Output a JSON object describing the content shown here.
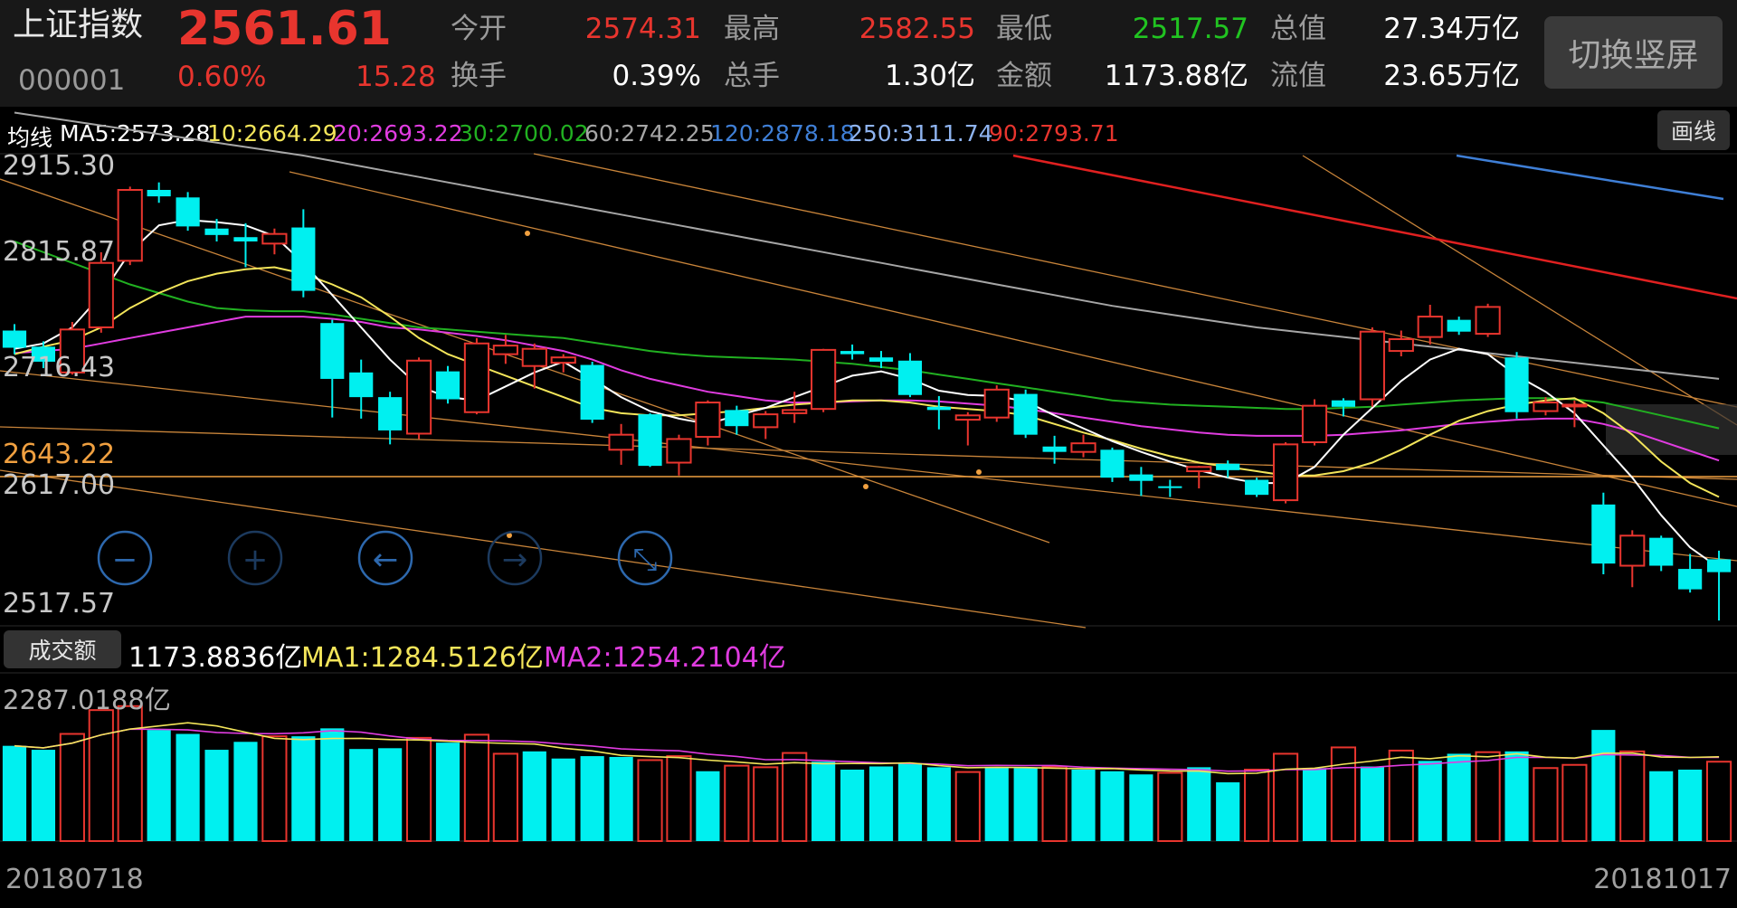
{
  "header": {
    "name": "上证指数",
    "code": "000001",
    "price": "2561.61",
    "change_pct": "0.60%",
    "change": "15.28",
    "fields": [
      {
        "label": "今开",
        "value": "2574.31",
        "color": "#e8352e"
      },
      {
        "label": "最高",
        "value": "2582.55",
        "color": "#e8352e"
      },
      {
        "label": "最低",
        "value": "2517.57",
        "color": "#21c421"
      },
      {
        "label": "总值",
        "value": "27.34万亿",
        "color": "#ffffff"
      },
      {
        "label": "换手",
        "value": "0.39%",
        "color": "#ffffff"
      },
      {
        "label": "总手",
        "value": "1.30亿",
        "color": "#ffffff"
      },
      {
        "label": "金额",
        "value": "1173.88亿",
        "color": "#ffffff"
      },
      {
        "label": "流值",
        "value": "23.65万亿",
        "color": "#ffffff"
      }
    ],
    "switch_label": "切换竖屏"
  },
  "ma_bar": {
    "label": "均线",
    "items": [
      {
        "text": "MA5:2573.28",
        "color": "#ffffff"
      },
      {
        "text": "10:2664.29",
        "color": "#f3e55a"
      },
      {
        "text": "20:2693.22",
        "color": "#e03ce0"
      },
      {
        "text": "30:2700.02",
        "color": "#21b021"
      },
      {
        "text": "60:2742.25",
        "color": "#a6a6a6"
      },
      {
        "text": "120:2878.18",
        "color": "#3f7fd6"
      },
      {
        "text": "250:3111.74",
        "color": "#8fb4f0"
      },
      {
        "text": "90:2793.71",
        "color": "#e8352e"
      }
    ],
    "draw_label": "画线"
  },
  "price_axis": {
    "ticks": [
      {
        "text": "2915.30",
        "color": "#c8c8c8"
      },
      {
        "text": "2815.87",
        "color": "#c8c8c8"
      },
      {
        "text": "2716.43",
        "color": "#c8c8c8"
      },
      {
        "text": "2643.22",
        "color": "#f0a040"
      },
      {
        "text": "2617.00",
        "color": "#c8c8c8"
      },
      {
        "text": "2517.57",
        "color": "#c8c8c8"
      }
    ]
  },
  "controls": [
    {
      "name": "zoom-out-icon",
      "glyph": "−"
    },
    {
      "name": "zoom-in-icon",
      "glyph": "+"
    },
    {
      "name": "scroll-left-icon",
      "glyph": "←"
    },
    {
      "name": "scroll-right-icon",
      "glyph": "→"
    },
    {
      "name": "reset-view-icon",
      "glyph": "⤡"
    }
  ],
  "volume": {
    "tab_label": "成交额",
    "value": "1173.8836亿",
    "ma1": "MA1:1284.5126亿",
    "ma2": "MA2:1254.2104亿",
    "max_label": "2287.0188亿",
    "ma1_color": "#f3e55a",
    "ma2_color": "#e03ce0"
  },
  "dates": {
    "start": "20180718",
    "end": "20181017"
  },
  "chart_data": {
    "type": "candlestick",
    "x_range": [
      "20180718",
      "20181017"
    ],
    "y_ticks": [
      2915.3,
      2815.87,
      2716.43,
      2643.22,
      2617.0,
      2517.57
    ],
    "candles": [
      {
        "o": 2787,
        "c": 2771,
        "h": 2793,
        "l": 2765,
        "up": false
      },
      {
        "o": 2772,
        "c": 2758,
        "h": 2777,
        "l": 2752,
        "up": false
      },
      {
        "o": 2748,
        "c": 2788,
        "h": 2795,
        "l": 2746,
        "up": true
      },
      {
        "o": 2790,
        "c": 2850,
        "h": 2860,
        "l": 2785,
        "up": true
      },
      {
        "o": 2852,
        "c": 2918,
        "h": 2921,
        "l": 2848,
        "up": true
      },
      {
        "o": 2918,
        "c": 2912,
        "h": 2925,
        "l": 2906,
        "up": false
      },
      {
        "o": 2911,
        "c": 2884,
        "h": 2916,
        "l": 2880,
        "up": false
      },
      {
        "o": 2882,
        "c": 2876,
        "h": 2891,
        "l": 2870,
        "up": false
      },
      {
        "o": 2874,
        "c": 2870,
        "h": 2887,
        "l": 2846,
        "up": false
      },
      {
        "o": 2868,
        "c": 2877,
        "h": 2882,
        "l": 2858,
        "up": true
      },
      {
        "o": 2883,
        "c": 2824,
        "h": 2900,
        "l": 2818,
        "up": false
      },
      {
        "o": 2794,
        "c": 2742,
        "h": 2797,
        "l": 2706,
        "up": false
      },
      {
        "o": 2748,
        "c": 2725,
        "h": 2760,
        "l": 2705,
        "up": false
      },
      {
        "o": 2725,
        "c": 2694,
        "h": 2730,
        "l": 2681,
        "up": false
      },
      {
        "o": 2691,
        "c": 2759,
        "h": 2762,
        "l": 2686,
        "up": true
      },
      {
        "o": 2749,
        "c": 2723,
        "h": 2754,
        "l": 2719,
        "up": false
      },
      {
        "o": 2711,
        "c": 2775,
        "h": 2780,
        "l": 2709,
        "up": true
      },
      {
        "o": 2765,
        "c": 2773,
        "h": 2783,
        "l": 2756,
        "up": true
      },
      {
        "o": 2770,
        "c": 2754,
        "h": 2775,
        "l": 2733,
        "up": true
      },
      {
        "o": 2757,
        "c": 2762,
        "h": 2765,
        "l": 2748,
        "up": true
      },
      {
        "o": 2755,
        "c": 2704,
        "h": 2758,
        "l": 2701,
        "up": false
      },
      {
        "o": 2676,
        "c": 2690,
        "h": 2700,
        "l": 2662,
        "up": true
      },
      {
        "o": 2661,
        "c": 2709,
        "h": 2710,
        "l": 2660,
        "up": false
      },
      {
        "o": 2664,
        "c": 2686,
        "h": 2690,
        "l": 2652,
        "up": true
      },
      {
        "o": 2688,
        "c": 2720,
        "h": 2722,
        "l": 2680,
        "up": true
      },
      {
        "o": 2713,
        "c": 2698,
        "h": 2717,
        "l": 2690,
        "up": false
      },
      {
        "o": 2697,
        "c": 2709,
        "h": 2712,
        "l": 2686,
        "up": true
      },
      {
        "o": 2710,
        "c": 2713,
        "h": 2730,
        "l": 2701,
        "up": true
      },
      {
        "o": 2714,
        "c": 2769,
        "h": 2770,
        "l": 2711,
        "up": true
      },
      {
        "o": 2768,
        "c": 2765,
        "h": 2774,
        "l": 2760,
        "up": false
      },
      {
        "o": 2762,
        "c": 2758,
        "h": 2768,
        "l": 2752,
        "up": false
      },
      {
        "o": 2759,
        "c": 2727,
        "h": 2766,
        "l": 2725,
        "up": false
      },
      {
        "o": 2716,
        "c": 2713,
        "h": 2726,
        "l": 2695,
        "up": false
      },
      {
        "o": 2704,
        "c": 2708,
        "h": 2711,
        "l": 2680,
        "up": true
      },
      {
        "o": 2706,
        "c": 2732,
        "h": 2736,
        "l": 2702,
        "up": true
      },
      {
        "o": 2728,
        "c": 2690,
        "h": 2732,
        "l": 2687,
        "up": false
      },
      {
        "o": 2679,
        "c": 2674,
        "h": 2689,
        "l": 2663,
        "up": false
      },
      {
        "o": 2674,
        "c": 2682,
        "h": 2690,
        "l": 2669,
        "up": true
      },
      {
        "o": 2676,
        "c": 2650,
        "h": 2678,
        "l": 2646,
        "up": false
      },
      {
        "o": 2653,
        "c": 2647,
        "h": 2660,
        "l": 2633,
        "up": false
      },
      {
        "o": 2642,
        "c": 2641,
        "h": 2648,
        "l": 2632,
        "up": false
      },
      {
        "o": 2656,
        "c": 2660,
        "h": 2661,
        "l": 2640,
        "up": true
      },
      {
        "o": 2663,
        "c": 2657,
        "h": 2666,
        "l": 2650,
        "up": false
      },
      {
        "o": 2648,
        "c": 2634,
        "h": 2650,
        "l": 2632,
        "up": false
      },
      {
        "o": 2629,
        "c": 2681,
        "h": 2683,
        "l": 2626,
        "up": true
      },
      {
        "o": 2683,
        "c": 2717,
        "h": 2723,
        "l": 2680,
        "up": true
      },
      {
        "o": 2716,
        "c": 2722,
        "h": 2724,
        "l": 2707,
        "up": false
      },
      {
        "o": 2723,
        "c": 2786,
        "h": 2790,
        "l": 2716,
        "up": true
      },
      {
        "o": 2768,
        "c": 2779,
        "h": 2787,
        "l": 2763,
        "up": true
      },
      {
        "o": 2781,
        "c": 2800,
        "h": 2811,
        "l": 2774,
        "up": true
      },
      {
        "o": 2797,
        "c": 2786,
        "h": 2800,
        "l": 2783,
        "up": false
      },
      {
        "o": 2784,
        "c": 2809,
        "h": 2812,
        "l": 2781,
        "up": true
      },
      {
        "o": 2762,
        "c": 2711,
        "h": 2767,
        "l": 2705,
        "up": false
      },
      {
        "o": 2712,
        "c": 2720,
        "h": 2725,
        "l": 2708,
        "up": true
      },
      {
        "o": 2718,
        "c": 2718,
        "h": 2722,
        "l": 2697,
        "up": true
      },
      {
        "o": 2625,
        "c": 2570,
        "h": 2636,
        "l": 2560,
        "up": false
      },
      {
        "o": 2596,
        "c": 2568,
        "h": 2601,
        "l": 2548,
        "up": true
      },
      {
        "o": 2594,
        "c": 2568,
        "h": 2596,
        "l": 2563,
        "up": false
      },
      {
        "o": 2565,
        "c": 2546,
        "h": 2579,
        "l": 2543,
        "up": false
      },
      {
        "o": 2562,
        "c": 2574,
        "h": 2582,
        "l": 2517,
        "up": false
      }
    ],
    "ma_series": [
      {
        "name": "MA5",
        "color": "#ffffff",
        "values": [
          2770,
          2775,
          2790,
          2820,
          2860,
          2885,
          2890,
          2888,
          2885,
          2875,
          2850,
          2820,
          2790,
          2760,
          2735,
          2725,
          2722,
          2735,
          2748,
          2758,
          2742,
          2725,
          2712,
          2705,
          2700,
          2708,
          2715,
          2725,
          2735,
          2745,
          2749,
          2742,
          2731,
          2727,
          2726,
          2721,
          2708,
          2696,
          2684,
          2674,
          2665,
          2657,
          2650,
          2645,
          2645,
          2660,
          2690,
          2715,
          2740,
          2760,
          2770,
          2765,
          2745,
          2730,
          2710,
          2680,
          2650,
          2615,
          2585,
          2566
        ]
      },
      {
        "name": "MA10",
        "color": "#f3e55a",
        "values": [
          2765,
          2772,
          2778,
          2790,
          2808,
          2822,
          2833,
          2840,
          2844,
          2846,
          2840,
          2830,
          2818,
          2800,
          2780,
          2765,
          2755,
          2745,
          2735,
          2725,
          2715,
          2710,
          2708,
          2708,
          2710,
          2712,
          2715,
          2718,
          2720,
          2722,
          2722,
          2720,
          2716,
          2714,
          2712,
          2708,
          2700,
          2692,
          2685,
          2677,
          2670,
          2664,
          2660,
          2656,
          2652,
          2652,
          2656,
          2664,
          2676,
          2690,
          2703,
          2712,
          2718,
          2722,
          2724,
          2710,
          2690,
          2665,
          2645,
          2632
        ]
      },
      {
        "name": "MA20",
        "color": "#e03ce0",
        "values": [
          2766,
          2768,
          2770,
          2775,
          2780,
          2785,
          2790,
          2795,
          2800,
          2800,
          2800,
          2798,
          2795,
          2790,
          2788,
          2785,
          2782,
          2778,
          2773,
          2768,
          2760,
          2750,
          2742,
          2736,
          2730,
          2726,
          2722,
          2720,
          2720,
          2721,
          2722,
          2722,
          2721,
          2719,
          2717,
          2714,
          2710,
          2706,
          2702,
          2698,
          2695,
          2692,
          2690,
          2689,
          2689,
          2689,
          2690,
          2692,
          2694,
          2697,
          2700,
          2702,
          2704,
          2705,
          2705,
          2700,
          2693,
          2684,
          2675,
          2666
        ]
      },
      {
        "name": "MA30",
        "color": "#21b021",
        "values": [
          2870,
          2860,
          2850,
          2840,
          2830,
          2822,
          2814,
          2808,
          2806,
          2805,
          2805,
          2802,
          2798,
          2794,
          2790,
          2788,
          2786,
          2784,
          2782,
          2780,
          2776,
          2772,
          2768,
          2765,
          2763,
          2762,
          2761,
          2760,
          2758,
          2756,
          2753,
          2750,
          2746,
          2742,
          2738,
          2734,
          2730,
          2726,
          2722,
          2720,
          2718,
          2717,
          2716,
          2715,
          2714,
          2714,
          2715,
          2716,
          2718,
          2720,
          2722,
          2723,
          2724,
          2724,
          2723,
          2720,
          2714,
          2708,
          2702,
          2696
        ]
      },
      {
        "name": "MA60",
        "color": "#a6a6a6",
        "values": [
          2990,
          2986,
          2982,
          2978,
          2974,
          2970,
          2966,
          2962,
          2958,
          2954,
          2950,
          2945,
          2940,
          2935,
          2930,
          2925,
          2920,
          2915,
          2910,
          2905,
          2900,
          2895,
          2890,
          2885,
          2880,
          2875,
          2870,
          2865,
          2860,
          2855,
          2850,
          2845,
          2840,
          2835,
          2830,
          2825,
          2820,
          2815,
          2810,
          2806,
          2802,
          2798,
          2794,
          2790,
          2787,
          2784,
          2781,
          2778,
          2775,
          2772,
          2769,
          2766,
          2763,
          2760,
          2757,
          2754,
          2751,
          2748,
          2745,
          2742
        ]
      }
    ],
    "volume_bars": [
      {
        "v": 1200,
        "up": false
      },
      {
        "v": 1150,
        "up": false
      },
      {
        "v": 1350,
        "up": true
      },
      {
        "v": 1650,
        "up": true
      },
      {
        "v": 1700,
        "up": true
      },
      {
        "v": 1400,
        "up": false
      },
      {
        "v": 1350,
        "up": false
      },
      {
        "v": 1150,
        "up": false
      },
      {
        "v": 1250,
        "up": false
      },
      {
        "v": 1320,
        "up": true
      },
      {
        "v": 1320,
        "up": false
      },
      {
        "v": 1420,
        "up": false
      },
      {
        "v": 1160,
        "up": false
      },
      {
        "v": 1170,
        "up": false
      },
      {
        "v": 1300,
        "up": true
      },
      {
        "v": 1240,
        "up": false
      },
      {
        "v": 1340,
        "up": true
      },
      {
        "v": 1100,
        "up": true
      },
      {
        "v": 1130,
        "up": false
      },
      {
        "v": 1040,
        "up": false
      },
      {
        "v": 1070,
        "up": false
      },
      {
        "v": 1060,
        "up": false
      },
      {
        "v": 1020,
        "up": true
      },
      {
        "v": 1070,
        "up": true
      },
      {
        "v": 880,
        "up": false
      },
      {
        "v": 950,
        "up": true
      },
      {
        "v": 930,
        "up": true
      },
      {
        "v": 1110,
        "up": true
      },
      {
        "v": 1000,
        "up": false
      },
      {
        "v": 900,
        "up": false
      },
      {
        "v": 940,
        "up": false
      },
      {
        "v": 980,
        "up": false
      },
      {
        "v": 930,
        "up": false
      },
      {
        "v": 870,
        "up": true
      },
      {
        "v": 930,
        "up": false
      },
      {
        "v": 920,
        "up": false
      },
      {
        "v": 940,
        "up": true
      },
      {
        "v": 900,
        "up": false
      },
      {
        "v": 880,
        "up": false
      },
      {
        "v": 840,
        "up": false
      },
      {
        "v": 860,
        "up": true
      },
      {
        "v": 930,
        "up": false
      },
      {
        "v": 740,
        "up": false
      },
      {
        "v": 900,
        "up": true
      },
      {
        "v": 1100,
        "up": true
      },
      {
        "v": 920,
        "up": false
      },
      {
        "v": 1180,
        "up": true
      },
      {
        "v": 940,
        "up": false
      },
      {
        "v": 1140,
        "up": true
      },
      {
        "v": 1010,
        "up": false
      },
      {
        "v": 1100,
        "up": false
      },
      {
        "v": 1120,
        "up": true
      },
      {
        "v": 1130,
        "up": false
      },
      {
        "v": 920,
        "up": true
      },
      {
        "v": 960,
        "up": true
      },
      {
        "v": 1400,
        "up": false
      },
      {
        "v": 1130,
        "up": true
      },
      {
        "v": 880,
        "up": false
      },
      {
        "v": 900,
        "up": false
      },
      {
        "v": 1000,
        "up": true
      }
    ]
  }
}
